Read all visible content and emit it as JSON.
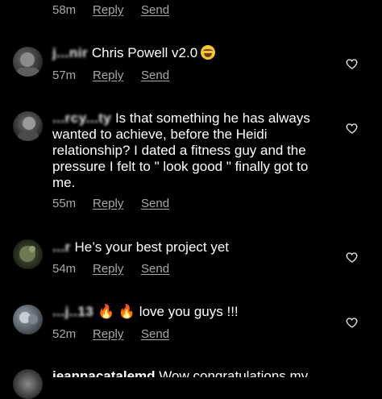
{
  "top_meta": {
    "time": "58m",
    "reply": "Reply",
    "send": "Send"
  },
  "comments": [
    {
      "username": "j...nir",
      "text": "Chris Powell v2.0",
      "emoji": "laughing-tears-emoji",
      "time": "57m",
      "reply": "Reply",
      "send": "Send"
    },
    {
      "username": "...rcy...ty",
      "text": "Is that something he has always wanted to achieve, before the Heidi relationship? I dated a fitness guy and the pressure I felt to \" look good \" finally got to me.",
      "time": "55m",
      "reply": "Reply",
      "send": "Send"
    },
    {
      "username": "...r",
      "text": "He’s your best project yet",
      "time": "54m",
      "reply": "Reply",
      "send": "Send"
    },
    {
      "username": "...j..13",
      "fire": "🔥",
      "fire2": "🔥",
      "text": "love you guys !!!",
      "time": "52m",
      "reply": "Reply",
      "send": "Send"
    },
    {
      "username": "jeannacatalemd",
      "text": "Wow congratulations my"
    }
  ],
  "colors": {
    "background": "#000000",
    "text": "#ffffff",
    "meta": "#a8a8a8"
  },
  "icons": [
    "heart-outline-icon"
  ]
}
